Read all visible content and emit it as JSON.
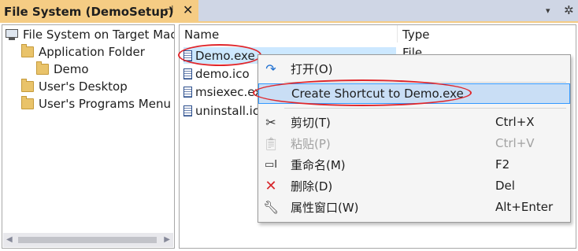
{
  "window": {
    "tab_title": "File System (DemoSetup)",
    "pin_glyph": "⊣",
    "close_glyph": "✕",
    "dropdown_glyph": "▾",
    "gear_glyph": "✲"
  },
  "tree": {
    "items": [
      {
        "label": "File System on Target Mac",
        "icon": "computer-icon"
      },
      {
        "label": "Application Folder",
        "icon": "folder-icon"
      },
      {
        "label": "Demo",
        "icon": "folder-icon"
      },
      {
        "label": "User's Desktop",
        "icon": "folder-icon"
      },
      {
        "label": "User's Programs Menu",
        "icon": "folder-icon"
      }
    ]
  },
  "file_list": {
    "columns": [
      "Name",
      "Type"
    ],
    "rows": [
      {
        "name": "Demo.exe",
        "type": "File"
      },
      {
        "name": "demo.ico"
      },
      {
        "name": "msiexec.exe"
      },
      {
        "name": "uninstall.ico"
      }
    ]
  },
  "context_menu": {
    "items": [
      {
        "label": "打开(O)",
        "shortcut": "",
        "icon": "open-arrow-icon"
      },
      {
        "label": "Create Shortcut to Demo.exe",
        "shortcut": "",
        "icon": ""
      },
      {
        "label": "剪切(T)",
        "shortcut": "Ctrl+X",
        "icon": "scissors-icon"
      },
      {
        "label": "粘贴(P)",
        "shortcut": "Ctrl+V",
        "icon": "paste-icon"
      },
      {
        "label": "重命名(M)",
        "shortcut": "F2",
        "icon": "rename-icon"
      },
      {
        "label": "删除(D)",
        "shortcut": "Del",
        "icon": "delete-x-icon"
      },
      {
        "label": "属性窗口(W)",
        "shortcut": "Alt+Enter",
        "icon": "wrench-icon"
      }
    ]
  },
  "colors": {
    "tab_accent": "#f5cc84",
    "selection": "#cce8ff",
    "menu_highlight": "#c9def5",
    "annotation_circle": "#e0262b"
  }
}
